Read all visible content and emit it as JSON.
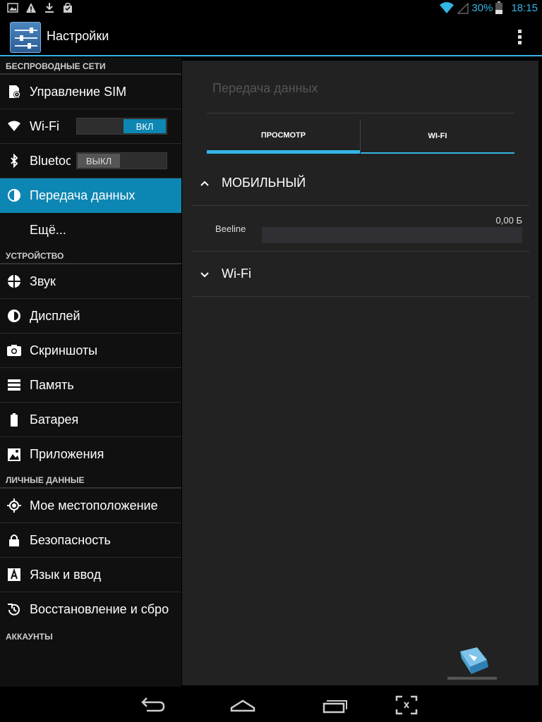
{
  "status_bar": {
    "notification_icons": [
      "image-icon",
      "warning-icon",
      "download-icon",
      "shopping-bag-icon"
    ],
    "battery_percent": "30%",
    "time": "18:15",
    "accent_color": "#33b5e5"
  },
  "action_bar": {
    "title": "Настройки",
    "icon": "settings-sliders-icon",
    "menu_icon": "overflow-menu-icon"
  },
  "sidebar": {
    "sections": [
      {
        "header": "БЕСПРОВОДНЫЕ СЕТИ",
        "items": [
          {
            "label": "Управление SIM",
            "icon": "sim-card-icon"
          },
          {
            "label": "Wi-Fi",
            "icon": "wifi-icon",
            "toggle": "ВКЛ",
            "toggle_on": true
          },
          {
            "label": "Bluetooth",
            "icon": "bluetooth-icon",
            "toggle": "ВЫКЛ",
            "toggle_on": false
          },
          {
            "label": "Передача данных",
            "icon": "data-usage-icon",
            "selected": true
          },
          {
            "label": "Ещё...",
            "icon": null
          }
        ]
      },
      {
        "header": "УСТРОЙСТВО",
        "items": [
          {
            "label": "Звук",
            "icon": "sound-icon"
          },
          {
            "label": "Дисплей",
            "icon": "brightness-icon"
          },
          {
            "label": "Скриншоты",
            "icon": "camera-icon"
          },
          {
            "label": "Память",
            "icon": "storage-icon"
          },
          {
            "label": "Батарея",
            "icon": "battery-icon"
          },
          {
            "label": "Приложения",
            "icon": "apps-icon"
          }
        ]
      },
      {
        "header": "ЛИЧНЫЕ ДАННЫЕ",
        "items": [
          {
            "label": "Мое местоположение",
            "icon": "location-icon"
          },
          {
            "label": "Безопасность",
            "icon": "lock-icon"
          },
          {
            "label": "Язык и ввод",
            "icon": "language-icon"
          },
          {
            "label": "Восстановление и сброс",
            "icon": "restore-icon"
          }
        ]
      },
      {
        "header": "АККАУНТЫ",
        "items": []
      }
    ]
  },
  "main": {
    "title": "Передача данных",
    "tabs": [
      {
        "label": "ПРОСМОТР",
        "active": true
      },
      {
        "label": "WI-FI",
        "active": false
      }
    ],
    "groups": [
      {
        "label": "МОБИЛЬНЫЙ",
        "expanded": true
      },
      {
        "label": "Wi-Fi",
        "expanded": false
      }
    ],
    "usage": {
      "name": "Beeline",
      "value": "0,00 Б",
      "fraction": 0
    }
  },
  "nav_bar": {
    "buttons": [
      "back-icon",
      "home-icon",
      "recent-apps-icon",
      "screenshot-icon"
    ]
  }
}
